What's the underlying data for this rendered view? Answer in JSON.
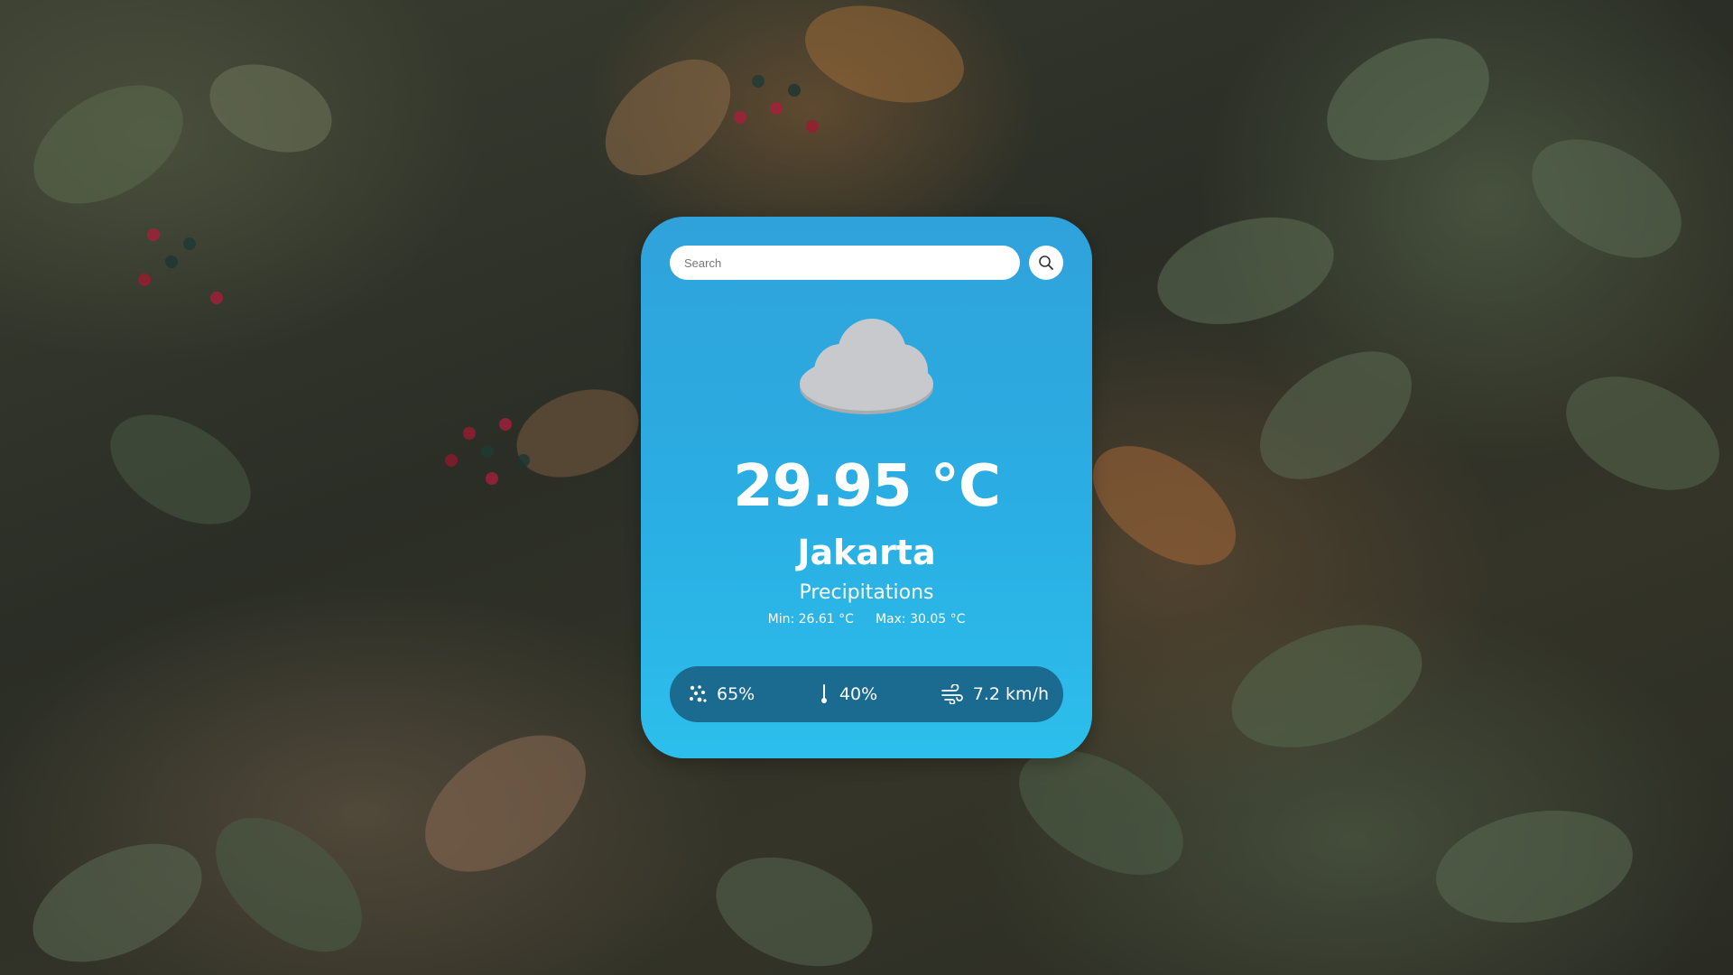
{
  "search": {
    "placeholder": "Search",
    "button_icon": "search-icon"
  },
  "weather": {
    "icon": "cloud-icon",
    "temperature": "29.95 °C",
    "city": "Jakarta",
    "condition": "Precipitations",
    "min": "Min: 26.61 °C",
    "max": "Max: 30.05 °C"
  },
  "stats": {
    "humidity": {
      "icon": "humidity-icon",
      "value": "65%"
    },
    "pressure": {
      "icon": "thermometer-icon",
      "value": "40%"
    },
    "wind": {
      "icon": "wind-icon",
      "value": "7.2 km/h"
    }
  },
  "colors": {
    "card_top": "#30a2db",
    "card_bottom": "#2cbfec",
    "stats_bar": "#1b6a90",
    "cloud": "#c7c9cc"
  }
}
